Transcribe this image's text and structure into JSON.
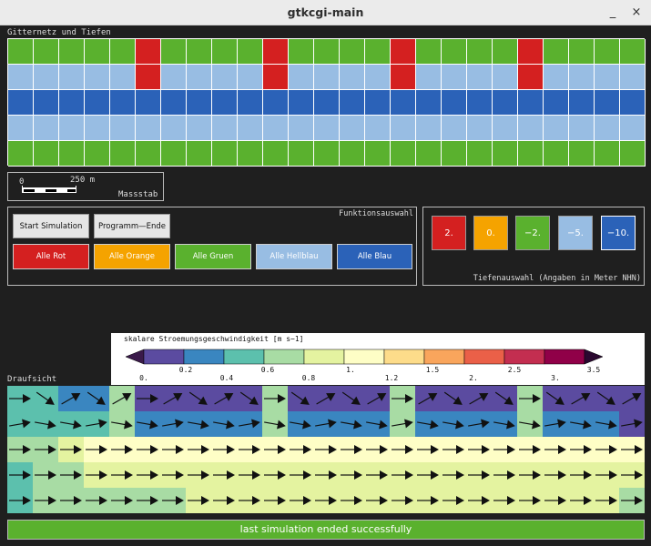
{
  "window": {
    "title": "gtkcgi-main",
    "minimize": "_",
    "close": "×"
  },
  "gitter": {
    "label": "Gitternetz und Tiefen",
    "rows": [
      [
        "g",
        "g",
        "g",
        "g",
        "g",
        "r",
        "g",
        "g",
        "g",
        "g",
        "r",
        "g",
        "g",
        "g",
        "g",
        "r",
        "g",
        "g",
        "g",
        "g",
        "r",
        "g",
        "g",
        "g",
        "g"
      ],
      [
        "l",
        "l",
        "l",
        "l",
        "l",
        "r",
        "l",
        "l",
        "l",
        "l",
        "r",
        "l",
        "l",
        "l",
        "l",
        "r",
        "l",
        "l",
        "l",
        "l",
        "r",
        "l",
        "l",
        "l",
        "l"
      ],
      [
        "b",
        "b",
        "b",
        "b",
        "b",
        "b",
        "b",
        "b",
        "b",
        "b",
        "b",
        "b",
        "b",
        "b",
        "b",
        "b",
        "b",
        "b",
        "b",
        "b",
        "b",
        "b",
        "b",
        "b",
        "b"
      ],
      [
        "l",
        "l",
        "l",
        "l",
        "l",
        "l",
        "l",
        "l",
        "l",
        "l",
        "l",
        "l",
        "l",
        "l",
        "l",
        "l",
        "l",
        "l",
        "l",
        "l",
        "l",
        "l",
        "l",
        "l",
        "l"
      ],
      [
        "g",
        "g",
        "g",
        "g",
        "g",
        "g",
        "g",
        "g",
        "g",
        "g",
        "g",
        "g",
        "g",
        "g",
        "g",
        "g",
        "g",
        "g",
        "g",
        "g",
        "g",
        "g",
        "g",
        "g",
        "g"
      ]
    ]
  },
  "colors": {
    "r": "#d42020",
    "o": "#f5a300",
    "g": "#5ab12e",
    "l": "#98bde3",
    "b": "#2b62b8"
  },
  "massstab": {
    "zero": "0",
    "distance": "250 m",
    "label": "Massstab"
  },
  "funktion": {
    "label": "Funktionsauswahl",
    "start": "Start Simulation",
    "ende": "Programm—Ende",
    "alle_rot": "Alle Rot",
    "alle_orange": "Alle Orange",
    "alle_gruen": "Alle Gruen",
    "alle_hellblau": "Alle Hellblau",
    "alle_blau": "Alle Blau"
  },
  "tiefen": {
    "label": "Tiefenauswahl (Angaben in Meter NHN)",
    "options": [
      {
        "value": "2.",
        "color": "#d42020"
      },
      {
        "value": "0.",
        "color": "#f5a300"
      },
      {
        "value": "−2.",
        "color": "#5ab12e"
      },
      {
        "value": "−5.",
        "color": "#98bde3"
      },
      {
        "value": "−10.",
        "color": "#2b62b8"
      }
    ],
    "selected": 4
  },
  "colorbar": {
    "title": "skalare Stroemungsgeschwindigkeit [m s−1]",
    "colors": [
      "#5b4ba0",
      "#3a86c0",
      "#5cc0ad",
      "#a8dca4",
      "#e4f3a0",
      "#fefec6",
      "#fddc8a",
      "#f9a55c",
      "#ea6048",
      "#c32e50",
      "#900048"
    ],
    "ticks_top": [
      "0.2",
      "0.6",
      "1.",
      "1.5",
      "2.5",
      "3.5"
    ],
    "ticks_bottom": [
      "0.",
      "0.4",
      "0.8",
      "1.2",
      "2.",
      "3."
    ]
  },
  "draufsicht": {
    "label": "Draufsicht",
    "rows": [
      [
        2,
        2,
        1,
        1,
        3,
        0,
        0,
        0,
        0,
        0,
        3,
        0,
        0,
        0,
        0,
        3,
        0,
        0,
        0,
        0,
        3,
        0,
        0,
        0,
        0
      ],
      [
        2,
        2,
        2,
        2,
        3,
        1,
        1,
        1,
        1,
        1,
        3,
        1,
        1,
        1,
        1,
        3,
        1,
        1,
        1,
        1,
        3,
        1,
        1,
        1,
        0
      ],
      [
        3,
        3,
        4,
        5,
        5,
        5,
        5,
        5,
        5,
        5,
        5,
        5,
        5,
        5,
        5,
        5,
        5,
        5,
        5,
        5,
        5,
        5,
        5,
        5,
        5
      ],
      [
        2,
        3,
        3,
        4,
        4,
        4,
        4,
        4,
        4,
        4,
        4,
        4,
        4,
        4,
        4,
        4,
        4,
        4,
        4,
        4,
        4,
        4,
        4,
        4,
        4
      ],
      [
        2,
        3,
        3,
        3,
        3,
        3,
        3,
        4,
        4,
        4,
        4,
        4,
        4,
        4,
        4,
        4,
        4,
        4,
        4,
        4,
        4,
        4,
        4,
        4,
        3
      ]
    ],
    "palette": [
      "#5b4ba0",
      "#3a86c0",
      "#5cc0ad",
      "#a8dca4",
      "#e4f3a0",
      "#fefec6",
      "#b5b5b5"
    ]
  },
  "status": "last simulation ended successfully"
}
